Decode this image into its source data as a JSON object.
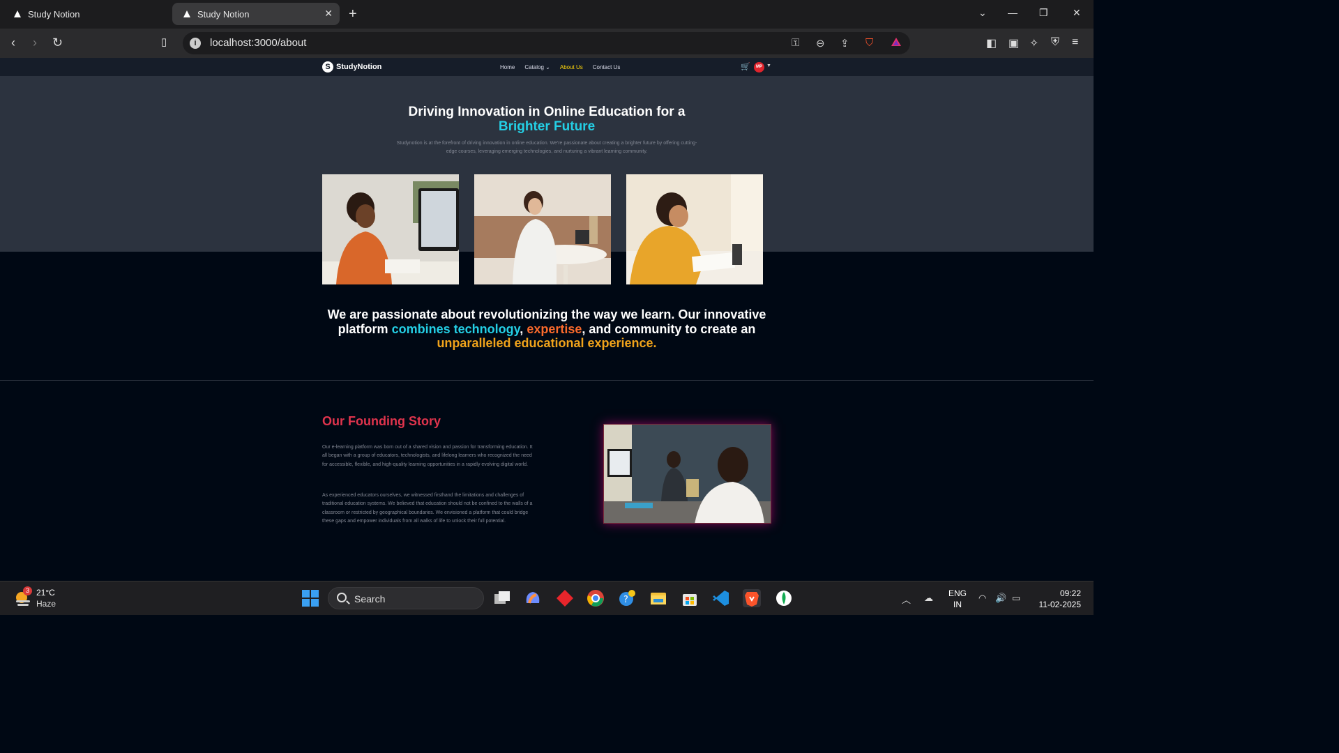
{
  "browser": {
    "tabs": [
      {
        "title": "Study Notion"
      },
      {
        "title": "Study Notion"
      }
    ],
    "url": "localhost:3000/about"
  },
  "site": {
    "logo": "StudyNotion",
    "nav": [
      "Home",
      "Catalog",
      "About Us",
      "Contact Us"
    ],
    "avatar_initials": "MP"
  },
  "hero": {
    "heading_line1": "Driving Innovation in Online Education for a",
    "heading_highlight": "Brighter Future",
    "description": "Studynotion is at the forefront of driving innovation in online education. We're passionate about creating a brighter future by offering cutting-edge courses, leveraging emerging technologies, and nurturing a vibrant learning community."
  },
  "quote": {
    "part1": "We are passionate about revolutionizing the way we learn. Our innovative platform",
    "highlight1": "combines technology",
    "sep1": ",",
    "highlight2": "expertise",
    "part2": ", and community to create an",
    "highlight3": "unparalleled educational experience."
  },
  "story": {
    "title": "Our Founding Story",
    "para1": "Our e-learning platform was born out of a shared vision and passion for transforming education. It all began with a group of educators, technologists, and lifelong learners who recognized the need for accessible, flexible, and high-quality learning opportunities in a rapidly evolving digital world.",
    "para2": "As experienced educators ourselves, we witnessed firsthand the limitations and challenges of traditional education systems. We believed that education should not be confined to the walls of a classroom or restricted by geographical boundaries. We envisioned a platform that could bridge these gaps and empower individuals from all walks of life to unlock their full potential."
  },
  "taskbar": {
    "weather_badge": "3",
    "temperature": "21°C",
    "condition": "Haze",
    "search_label": "Search",
    "lang_line1": "ENG",
    "lang_line2": "IN",
    "time": "09:22",
    "date": "11-02-2025"
  },
  "colors": {
    "accent_blue": "#24cfe5",
    "accent_orange": "#fa6a2c",
    "accent_gold": "#f0a31b",
    "story_red": "#e0344d",
    "nav_active": "#ffd60a"
  }
}
